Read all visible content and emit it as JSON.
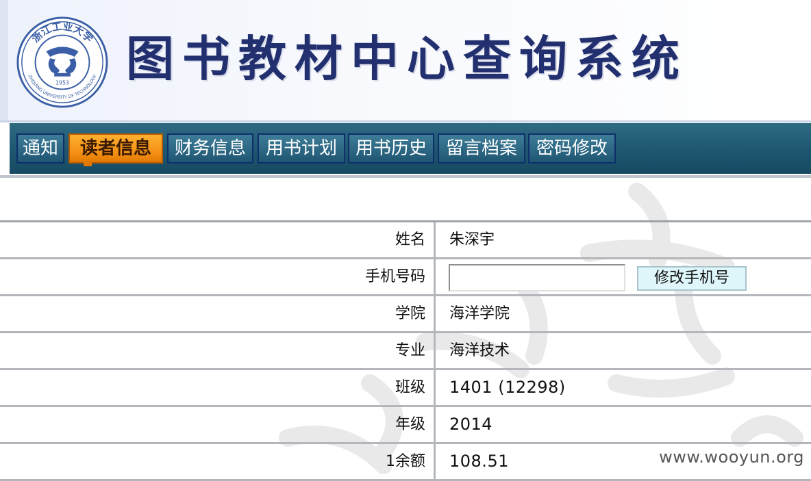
{
  "header": {
    "title": "图书教材中心查询系统",
    "logo": {
      "name": "university-logo",
      "arc_text": "浙江工业大学",
      "english_text": "ZHEJIANG UNIVERSITY OF TECHNOLOGY",
      "year": "1953",
      "color": "#3b5fa6"
    }
  },
  "nav": {
    "items": [
      {
        "label": "通知",
        "active": false
      },
      {
        "label": "读者信息",
        "active": true
      },
      {
        "label": "财务信息",
        "active": false
      },
      {
        "label": "用书计划",
        "active": false
      },
      {
        "label": "用书历史",
        "active": false
      },
      {
        "label": "留言档案",
        "active": false
      },
      {
        "label": "密码修改",
        "active": false
      }
    ]
  },
  "info": {
    "rows": [
      {
        "label": "姓名",
        "value": "朱深宇"
      },
      {
        "label": "手机号码",
        "input_value": "",
        "button_label": "修改手机号"
      },
      {
        "label": "学院",
        "value": "海洋学院"
      },
      {
        "label": "专业",
        "value": "海洋技术"
      },
      {
        "label": "班级",
        "value": "1401 (12298)"
      },
      {
        "label": "年级",
        "value": "2014"
      },
      {
        "label": "1余额",
        "value": "108.51"
      }
    ]
  },
  "watermark": {
    "text": "www.wooyun.org"
  },
  "colors": {
    "title": "#23306f",
    "nav_bg": "#1e5670",
    "nav_active": "#f28d12",
    "button_bg": "#dff6fb"
  }
}
